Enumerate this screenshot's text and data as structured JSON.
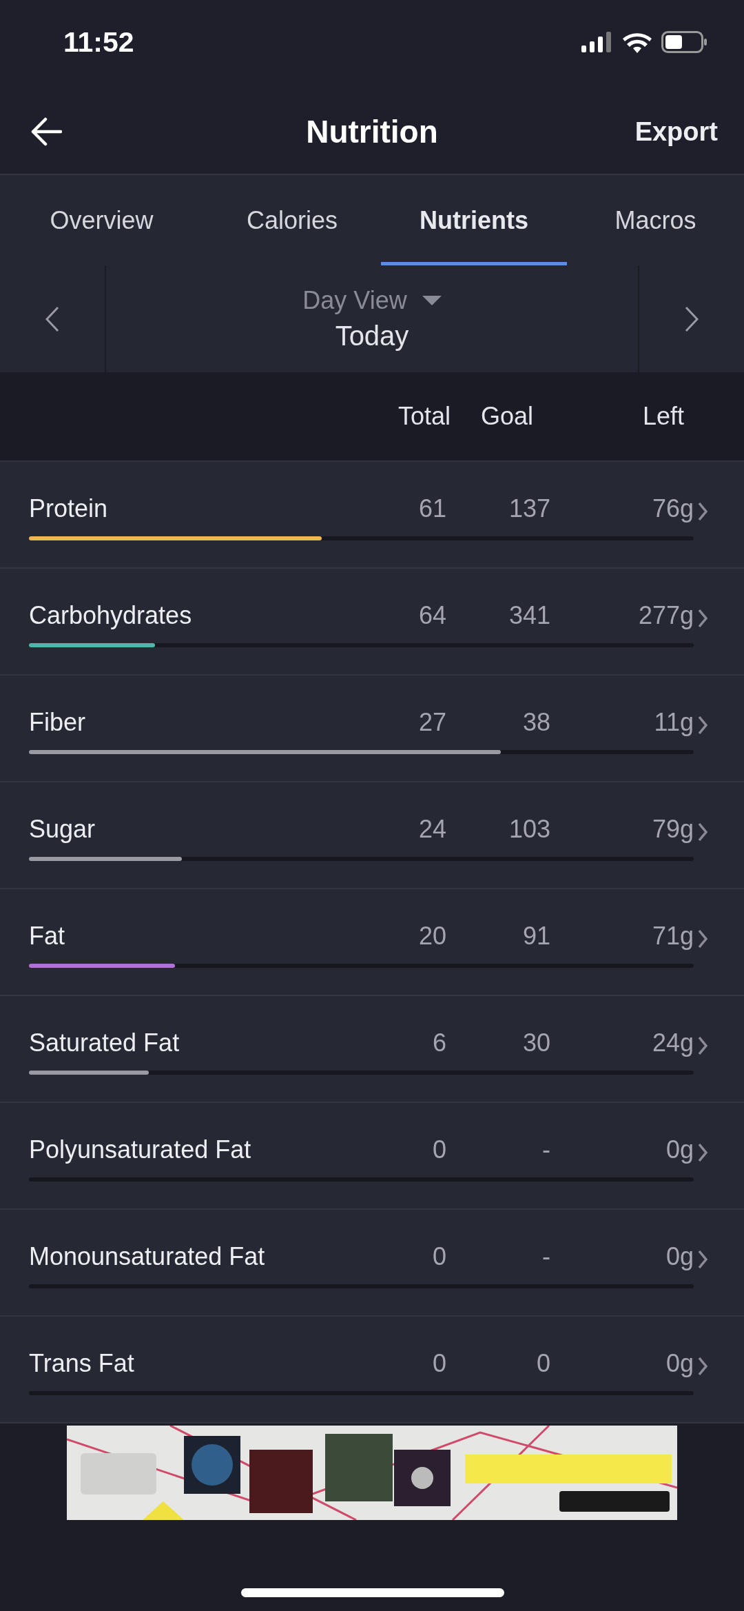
{
  "status_bar": {
    "time": "11:52"
  },
  "header": {
    "title": "Nutrition",
    "action": "Export"
  },
  "tabs": [
    {
      "label": "Overview",
      "selected": false
    },
    {
      "label": "Calories",
      "selected": false
    },
    {
      "label": "Nutrients",
      "selected": true
    },
    {
      "label": "Macros",
      "selected": false
    }
  ],
  "date_nav": {
    "view": "Day View",
    "date": "Today"
  },
  "table": {
    "columns": [
      "Total",
      "Goal",
      "Left"
    ],
    "rows": [
      {
        "name": "Protein",
        "total": "61",
        "goal": "137",
        "left": "76g",
        "level": 0.44,
        "color": "#f0b452"
      },
      {
        "name": "Carbohydrates",
        "total": "64",
        "goal": "341",
        "left": "277g",
        "level": 0.19,
        "color": "#4fb7a9"
      },
      {
        "name": "Fiber",
        "total": "27",
        "goal": "38",
        "left": "11g",
        "level": 0.71,
        "color": "#9a9ba2"
      },
      {
        "name": "Sugar",
        "total": "24",
        "goal": "103",
        "left": "79g",
        "level": 0.23,
        "color": "#9a9ba2"
      },
      {
        "name": "Fat",
        "total": "20",
        "goal": "91",
        "left": "71g",
        "level": 0.22,
        "color": "#b46fd6"
      },
      {
        "name": "Saturated Fat",
        "total": "6",
        "goal": "30",
        "left": "24g",
        "level": 0.18,
        "color": "#9a9ba2"
      },
      {
        "name": "Polyunsaturated Fat",
        "total": "0",
        "goal": "-",
        "left": "0g"
      },
      {
        "name": "Monounsaturated Fat",
        "total": "0",
        "goal": "-",
        "left": "0g"
      },
      {
        "name": "Trans Fat",
        "total": "0",
        "goal": "0",
        "left": "0g"
      }
    ]
  }
}
